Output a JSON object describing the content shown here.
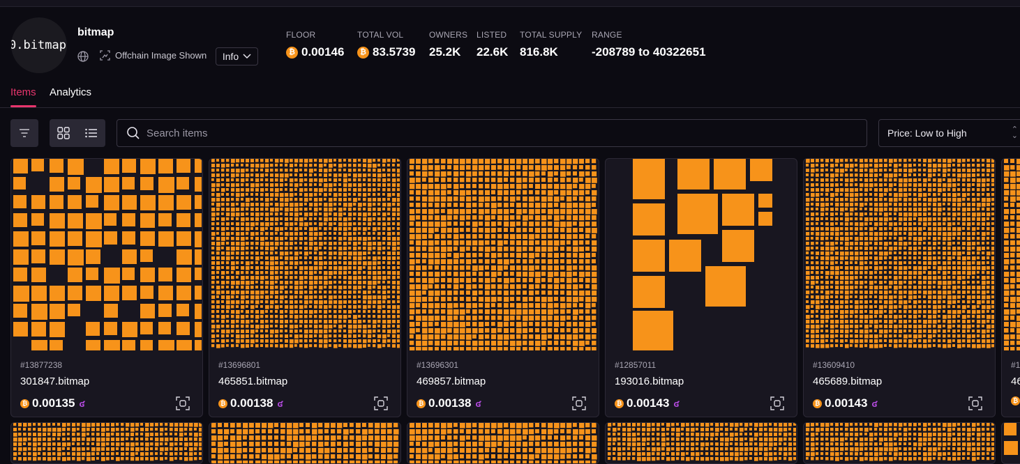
{
  "collection": {
    "logo_text": "0.bitmap",
    "name": "bitmap",
    "offchain_label": "Offchain Image Shown",
    "info_label": "Info"
  },
  "stats": {
    "floor": {
      "label": "FLOOR",
      "value": "0.00146"
    },
    "total_vol": {
      "label": "TOTAL VOL",
      "value": "83.5739"
    },
    "owners": {
      "label": "OWNERS",
      "value": "25.2K"
    },
    "listed": {
      "label": "LISTED",
      "value": "22.6K"
    },
    "total_supply": {
      "label": "TOTAL SUPPLY",
      "value": "816.8K"
    },
    "range": {
      "label": "RANGE",
      "value": "-208789 to 40322651"
    }
  },
  "tabs": [
    {
      "label": "Items",
      "active": true
    },
    {
      "label": "Analytics",
      "active": false
    }
  ],
  "search": {
    "placeholder": "Search items"
  },
  "sort": {
    "selected": "Price: Low to High"
  },
  "items": [
    {
      "inscription": "#13877238",
      "name": "301847.bitmap",
      "price": "0.00135",
      "pattern": "large"
    },
    {
      "inscription": "#13696801",
      "name": "465851.bitmap",
      "price": "0.00138",
      "pattern": "dense"
    },
    {
      "inscription": "#13696301",
      "name": "469857.bitmap",
      "price": "0.00138",
      "pattern": "medium"
    },
    {
      "inscription": "#12857011",
      "name": "193016.bitmap",
      "price": "0.00143",
      "pattern": "sparse"
    },
    {
      "inscription": "#13609410",
      "name": "465689.bitmap",
      "price": "0.00143",
      "pattern": "dense"
    },
    {
      "inscription": "#1",
      "name": "46",
      "price": "",
      "pattern": "medium"
    }
  ],
  "colors": {
    "accent": "#e8356d",
    "bitmap_orange": "#f7931a",
    "background": "#0c0b12"
  }
}
